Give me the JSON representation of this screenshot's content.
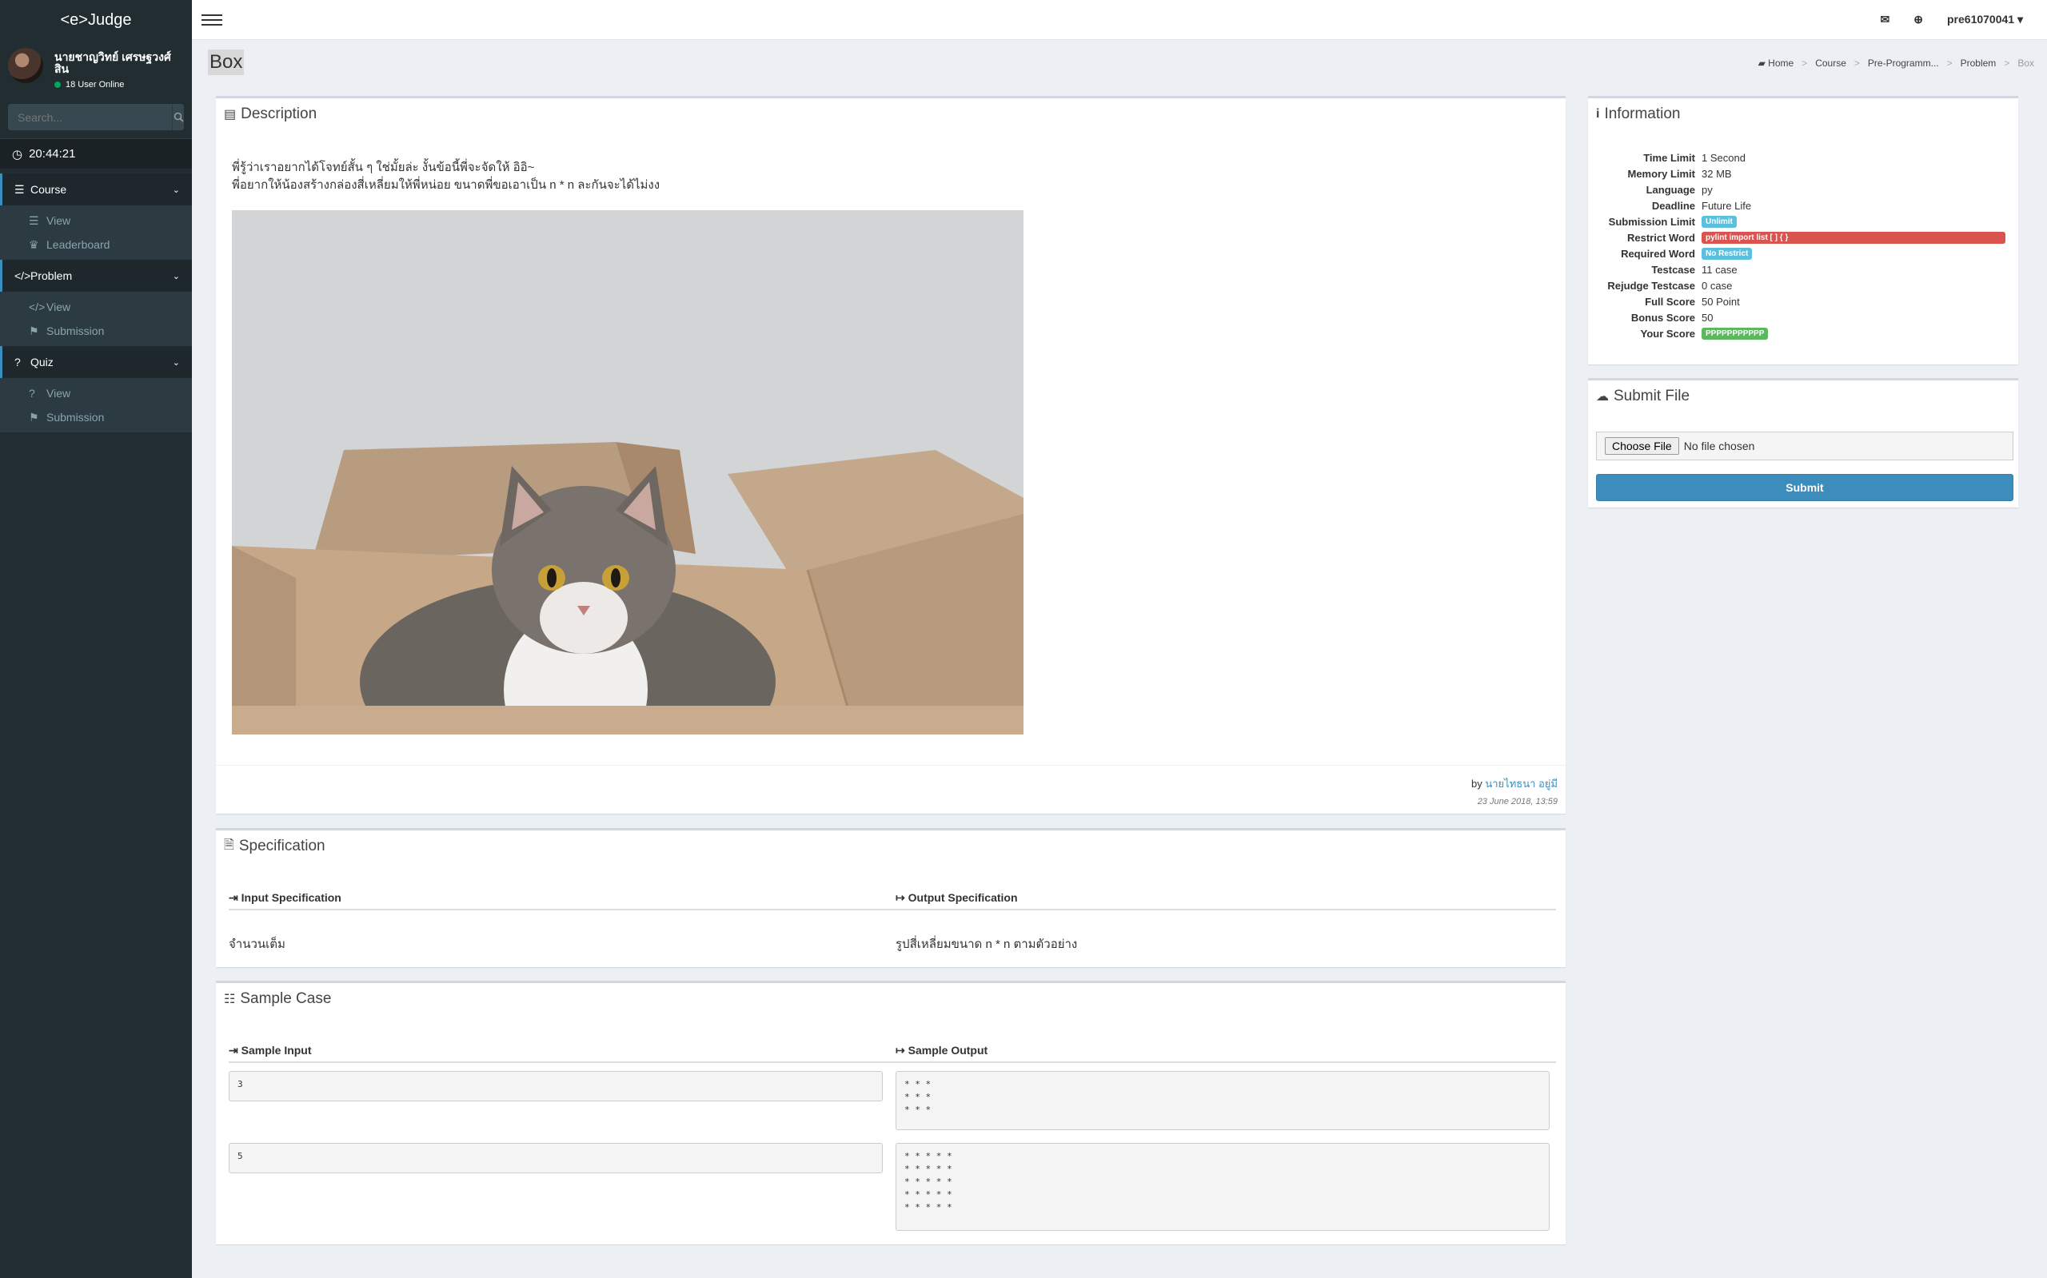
{
  "app": {
    "logo": "<e>Judge"
  },
  "user": {
    "name": "นายชาญวิทย์ เศรษฐวงศ์สิน",
    "online": "18 User Online"
  },
  "search": {
    "placeholder": "Search..."
  },
  "clock": {
    "time": "20:44:21"
  },
  "menu": {
    "course": {
      "label": "Course",
      "items": [
        "View",
        "Leaderboard"
      ]
    },
    "problem": {
      "label": "Problem",
      "items": [
        "View",
        "Submission"
      ]
    },
    "quiz": {
      "label": "Quiz",
      "items": [
        "View",
        "Submission"
      ]
    }
  },
  "topbar": {
    "username": "pre61070041"
  },
  "page": {
    "title": "Box"
  },
  "breadcrumb": [
    "Home",
    "Course",
    "Pre-Programm...",
    "Problem",
    "Box"
  ],
  "description": {
    "title": "Description",
    "line1": "พี่รู้ว่าเราอยากได้โจทย์สั้น ๆ ใช่มั้ยล่ะ งั้นข้อนี้พี่จะจัดให้ อิอิ~",
    "line2": "พี่อยากให้น้องสร้างกล่องสี่เหลี่ยมให้พี่หน่อย ขนาดพี่ขอเอาเป็น n * n ละกันจะได้ไม่งง",
    "by": "by",
    "author": "นายไทธนา อยู่มี",
    "date": "23 June 2018, 13:59"
  },
  "specification": {
    "title": "Specification",
    "input_head": "Input Specification",
    "output_head": "Output Specification",
    "input_text": "จำนวนเต็ม",
    "output_text": "รูปสี่เหลี่ยมขนาด n * n ตามตัวอย่าง"
  },
  "sample": {
    "title": "Sample Case",
    "input_head": "Sample Input",
    "output_head": "Sample Output",
    "cases": [
      {
        "input": "3",
        "output": "* * *\n* * *\n* * *"
      },
      {
        "input": "5",
        "output": "* * * * *\n* * * * *\n* * * * *\n* * * * *\n* * * * *"
      }
    ]
  },
  "information": {
    "title": "Information",
    "rows": [
      {
        "label": "Time Limit",
        "value": "1 Second"
      },
      {
        "label": "Memory Limit",
        "value": "32 MB"
      },
      {
        "label": "Language",
        "value": "py"
      },
      {
        "label": "Deadline",
        "value": "Future Life"
      },
      {
        "label": "Submission Limit",
        "value": "Unlimit"
      },
      {
        "label": "Restrict Word",
        "value": "pylint import list [ ] { }"
      },
      {
        "label": "Required Word",
        "value": "No Restrict"
      },
      {
        "label": "Testcase",
        "value": "11 case"
      },
      {
        "label": "Rejudge Testcase",
        "value": "0 case"
      },
      {
        "label": "Full Score",
        "value": "50 Point"
      },
      {
        "label": "Bonus Score",
        "value": "50"
      },
      {
        "label": "Your Score",
        "value": "PPPPPPPPPPP"
      }
    ]
  },
  "submit_file": {
    "title": "Submit File",
    "choose_label": "Choose File",
    "no_file": "No file chosen",
    "submit_label": "Submit"
  },
  "colors": {
    "accent": "#3c8dbc",
    "sidebar": "#222d32",
    "danger": "#d9534f",
    "success": "#5cb85c",
    "info": "#5bc0de"
  }
}
